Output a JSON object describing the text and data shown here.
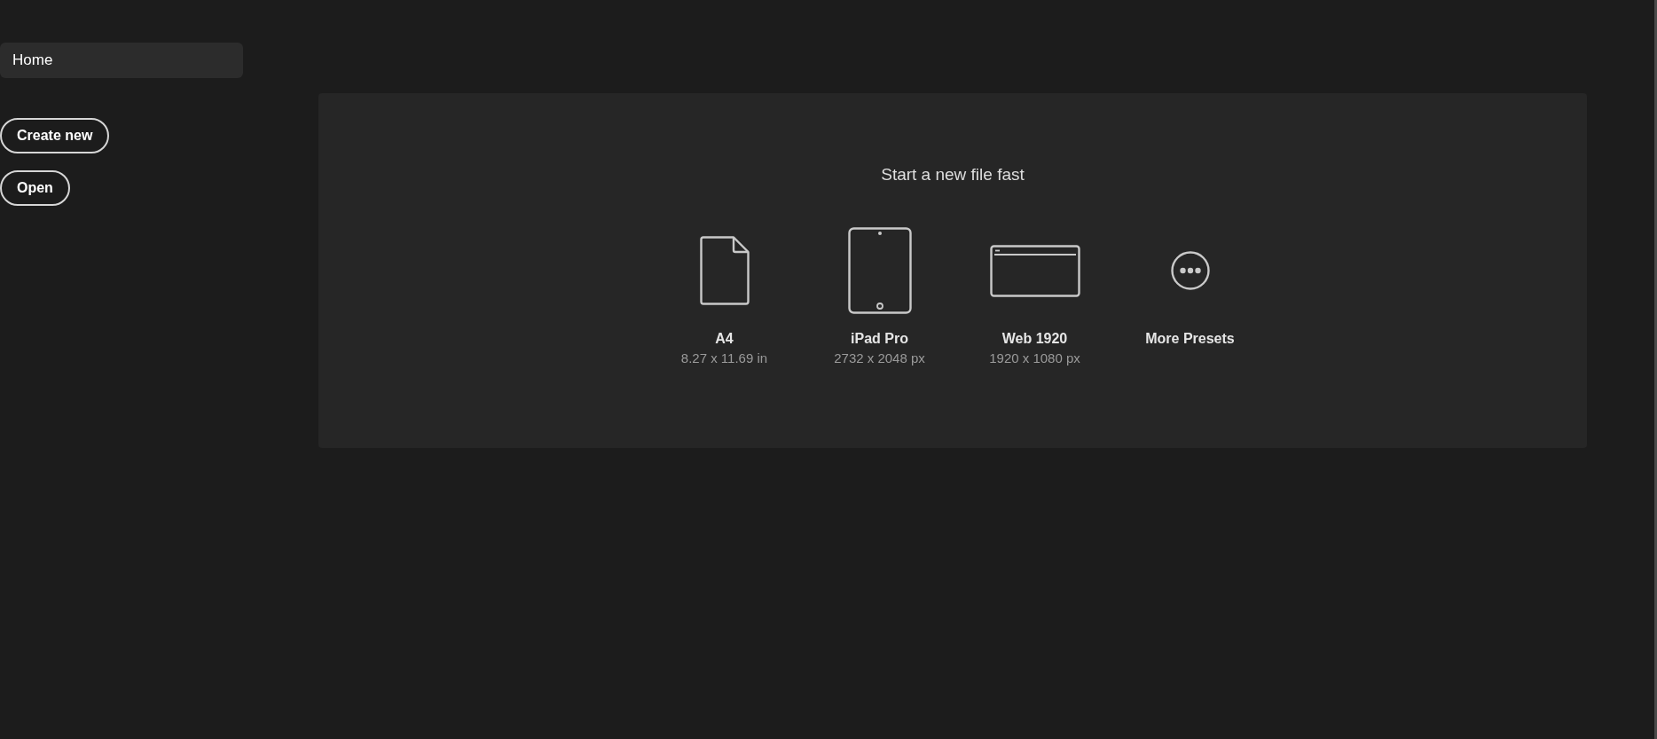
{
  "sidebar": {
    "items": [
      {
        "label": "Home",
        "selected": true
      }
    ],
    "buttons": [
      "Create new",
      "Open"
    ]
  },
  "panel": {
    "title": "Start a new file fast",
    "presets": [
      {
        "kind": "document",
        "name": "A4",
        "size": "8.27 x 11.69 in"
      },
      {
        "kind": "tablet",
        "name": "iPad Pro",
        "size": "2732 x 2048 px"
      },
      {
        "kind": "browser",
        "name": "Web 1920",
        "size": "1920 x 1080 px"
      },
      {
        "kind": "more",
        "name": "More Presets"
      }
    ]
  }
}
